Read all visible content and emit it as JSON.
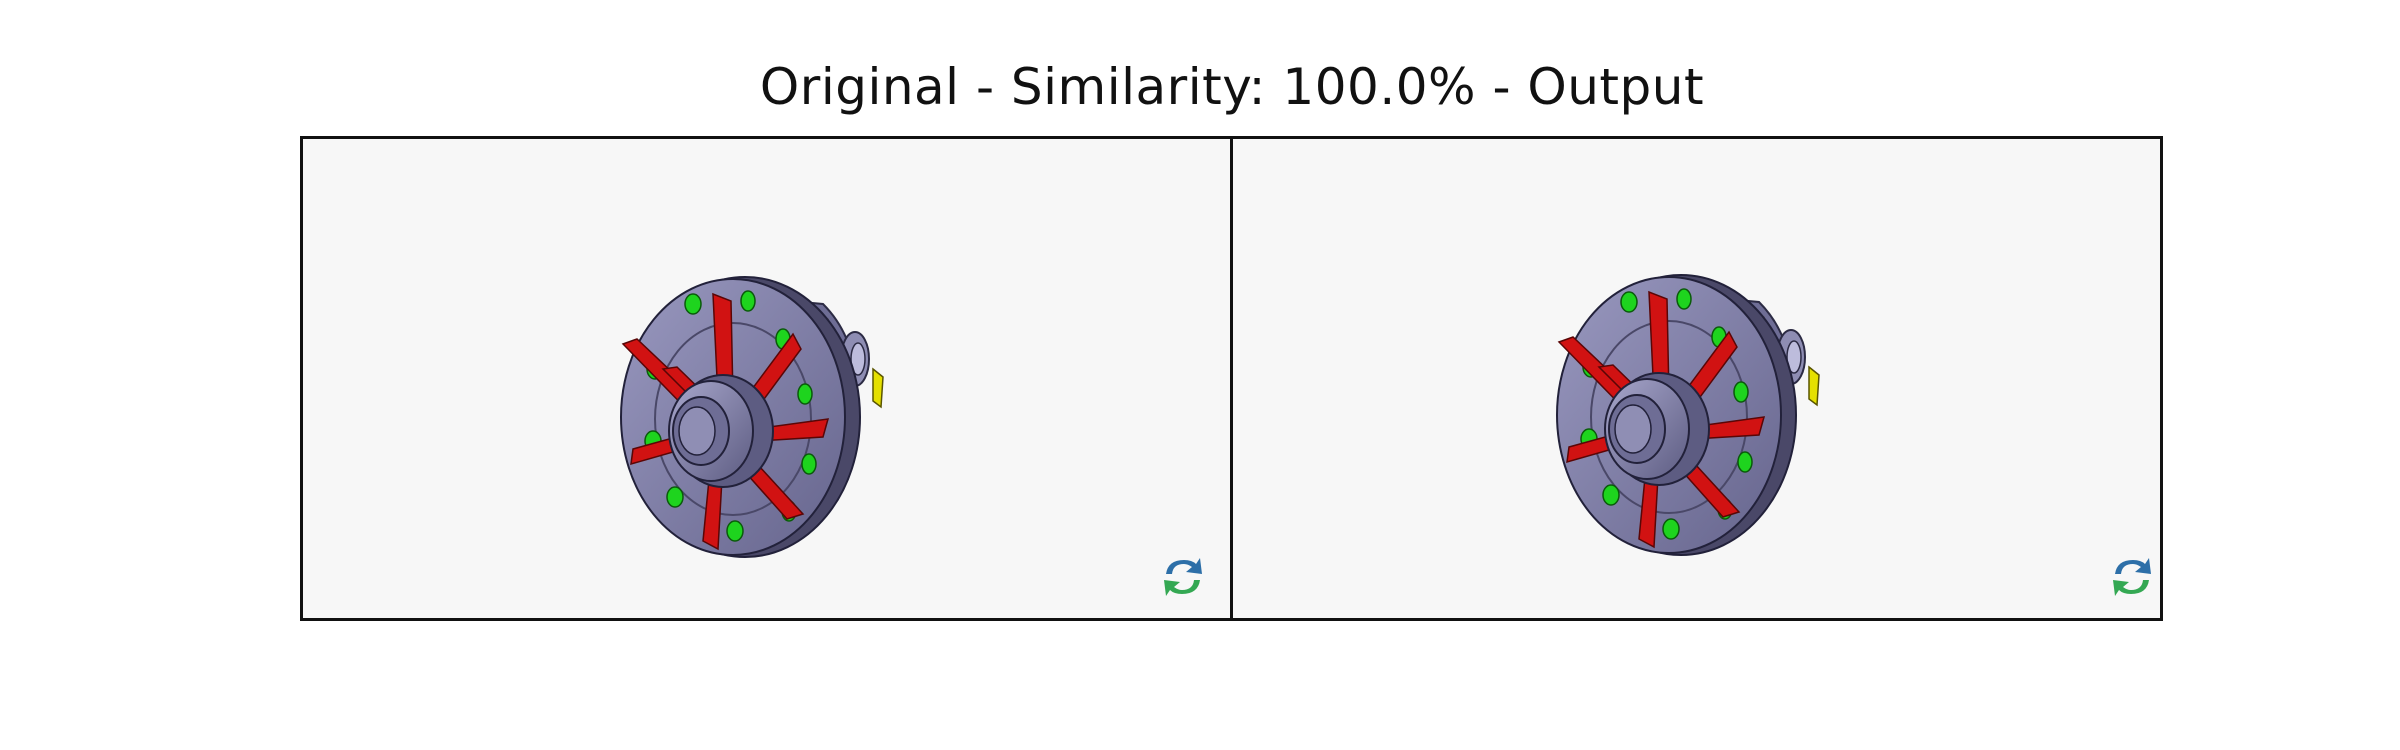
{
  "figure": {
    "title": "Original - Similarity: 100.0% - Output"
  },
  "panels": [
    {
      "id": "original",
      "icon": "cad-differential-part-icon",
      "action_icon": "refresh-sync-icon"
    },
    {
      "id": "output",
      "icon": "cad-differential-part-icon",
      "action_icon": "refresh-sync-icon"
    }
  ],
  "colors": {
    "background": "#f7f7f7",
    "body": "#7c7ba3",
    "body_dark": "#4a4868",
    "fins": "#d11212",
    "holes": "#1ed41e",
    "accent": "#e5e000",
    "gear": "#b59b72",
    "inner": "#8b0d12",
    "pink": "#d79ad8",
    "refresh_blue": "#2d6fa8",
    "refresh_green": "#34a853"
  }
}
